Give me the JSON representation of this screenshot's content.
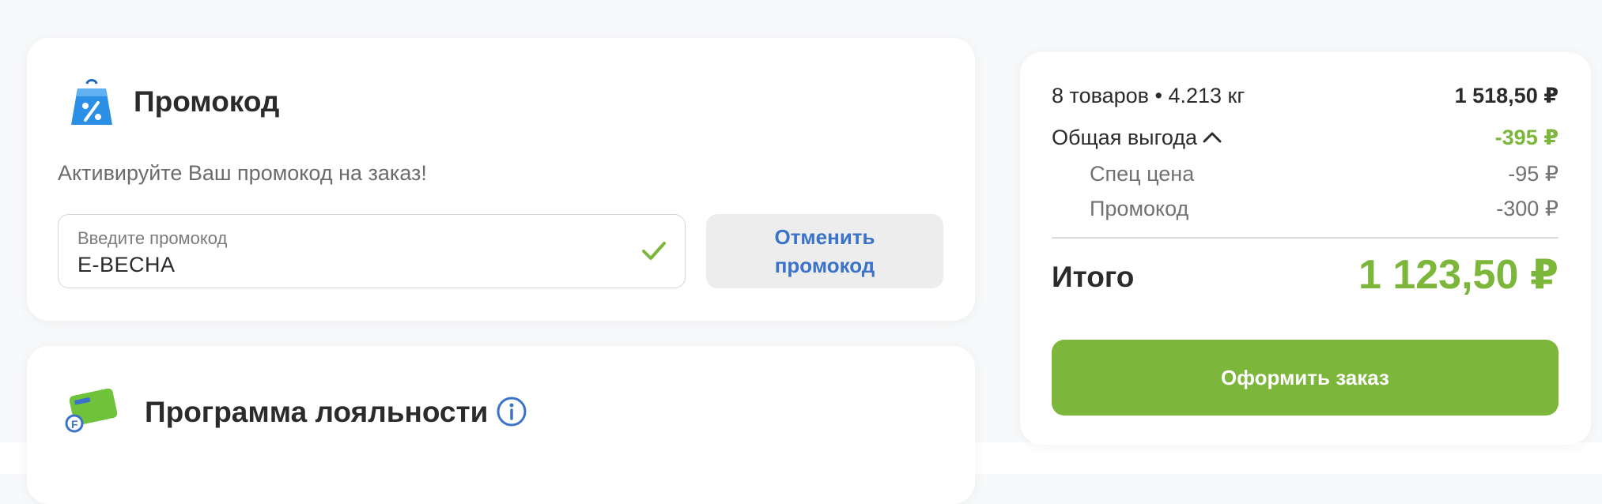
{
  "promo": {
    "title": "Промокод",
    "subtitle": "Активируйте Ваш промокод на заказ!",
    "input_label": "Введите промокод",
    "input_value": "E-ВЕСНА",
    "cancel_button": "Отменить промокод",
    "icon": "promo-bag-icon",
    "check_icon": "checkmark-icon"
  },
  "loyalty": {
    "title": "Программа лояльности",
    "icon": "loyalty-card-icon",
    "info_icon": "info-icon"
  },
  "summary": {
    "items_label": "8 товаров • 4.213 кг",
    "items_total": "1 518,50 ₽",
    "savings_label": "Общая выгода",
    "savings_value": "-395 ₽",
    "special_price_label": "Спец цена",
    "special_price_value": "-95 ₽",
    "promo_label": "Промокод",
    "promo_value": "-300 ₽",
    "total_label": "Итого",
    "total_value": "1 123,50 ₽",
    "checkout_button": "Оформить заказ"
  },
  "colors": {
    "accent_green": "#7cb63a",
    "link_blue": "#3b73c8",
    "promo_icon_blue": "#2c8fe6",
    "card_bg": "#ffffff",
    "page_bg": "#f8f9fa"
  }
}
